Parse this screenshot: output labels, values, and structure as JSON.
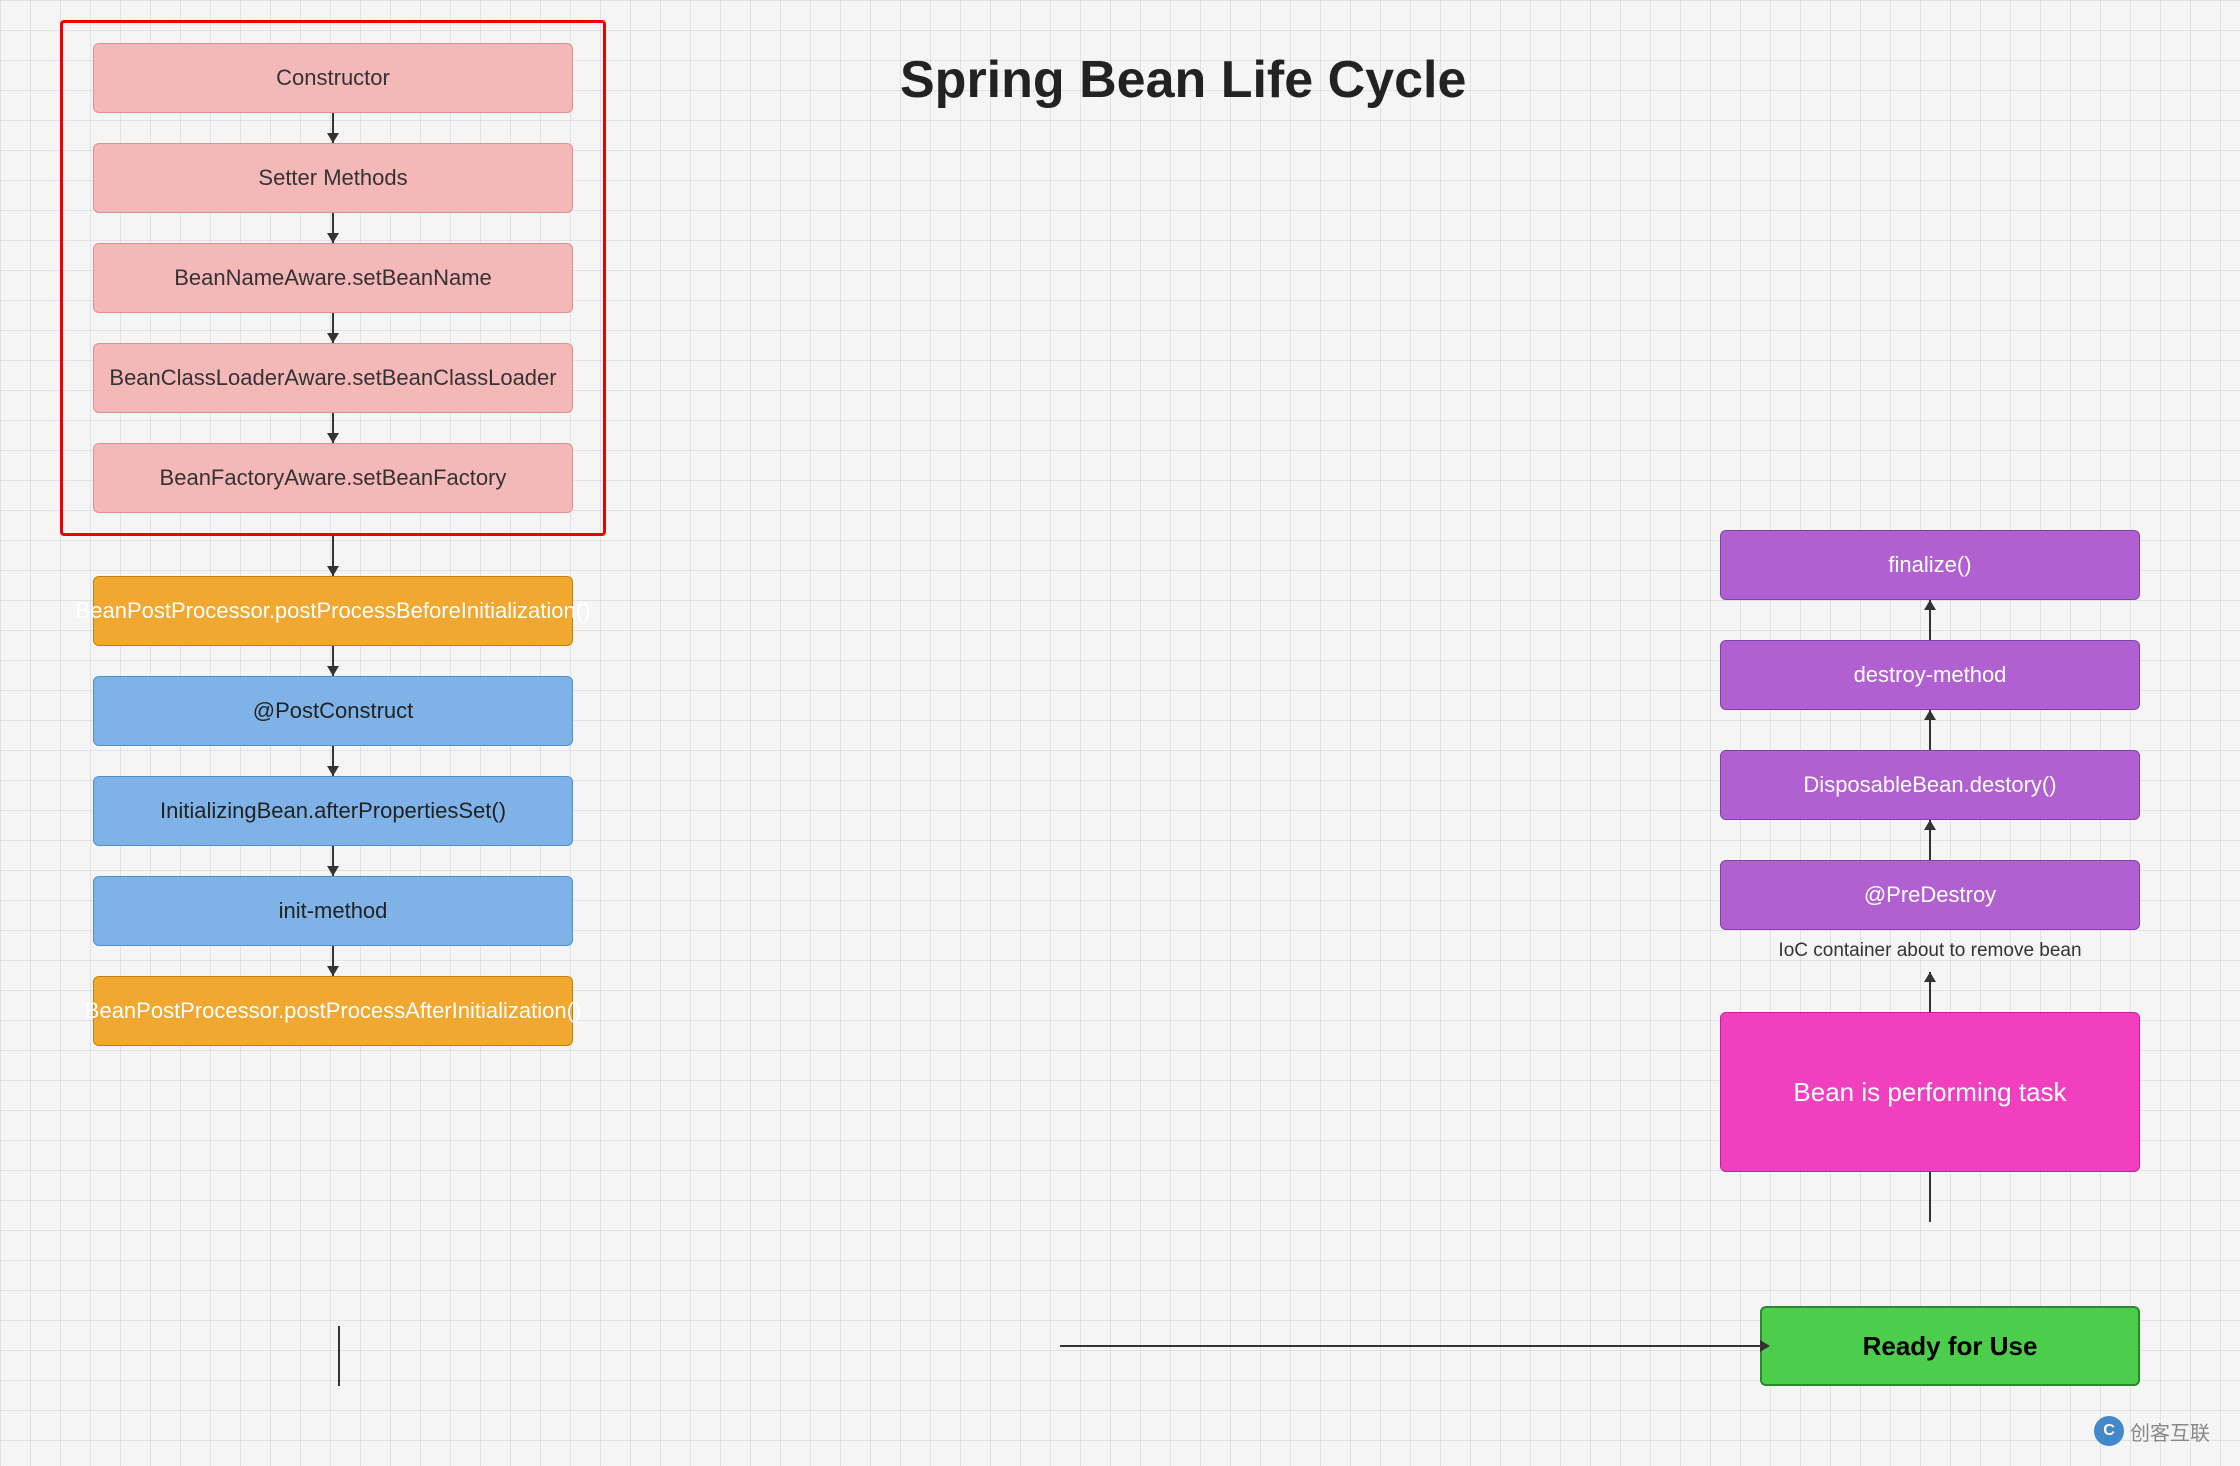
{
  "title": "Spring Bean Life Cycle",
  "left_flow": {
    "red_box_items": [
      {
        "id": "constructor",
        "label": "Constructor",
        "color": "pink"
      },
      {
        "id": "setter-methods",
        "label": "Setter Methods",
        "color": "pink"
      },
      {
        "id": "bean-name-aware",
        "label": "BeanNameAware.setBeanName",
        "color": "pink"
      },
      {
        "id": "bean-classloader-aware",
        "label": "BeanClassLoaderAware.setBeanClassLoader",
        "color": "pink"
      },
      {
        "id": "bean-factory-aware",
        "label": "BeanFactoryAware.setBeanFactory",
        "color": "pink"
      }
    ],
    "bottom_items": [
      {
        "id": "post-process-before",
        "label": "BeanPostProcessor.postProcessBeforeInitialization()",
        "color": "orange"
      },
      {
        "id": "post-construct",
        "label": "@PostConstruct",
        "color": "blue"
      },
      {
        "id": "initializing-bean",
        "label": "InitializingBean.afterPropertiesSet()",
        "color": "blue"
      },
      {
        "id": "init-method",
        "label": "init-method",
        "color": "blue"
      },
      {
        "id": "post-process-after",
        "label": "BeanPostProcessor.postProcessAfterInitialization()",
        "color": "orange"
      }
    ]
  },
  "right_flow": {
    "ready_for_use": "Ready for Use",
    "ioc_label": "IoC container about to remove bean",
    "items": [
      {
        "id": "bean-performing-task",
        "label": "Bean is performing task",
        "color": "magenta"
      },
      {
        "id": "pre-destroy",
        "label": "@PreDestroy",
        "color": "purple"
      },
      {
        "id": "disposable-bean",
        "label": "DisposableBean.destory()",
        "color": "purple"
      },
      {
        "id": "destroy-method",
        "label": "destroy-method",
        "color": "purple"
      },
      {
        "id": "finalize",
        "label": "finalize()",
        "color": "purple"
      }
    ]
  },
  "watermark": "创客互联"
}
